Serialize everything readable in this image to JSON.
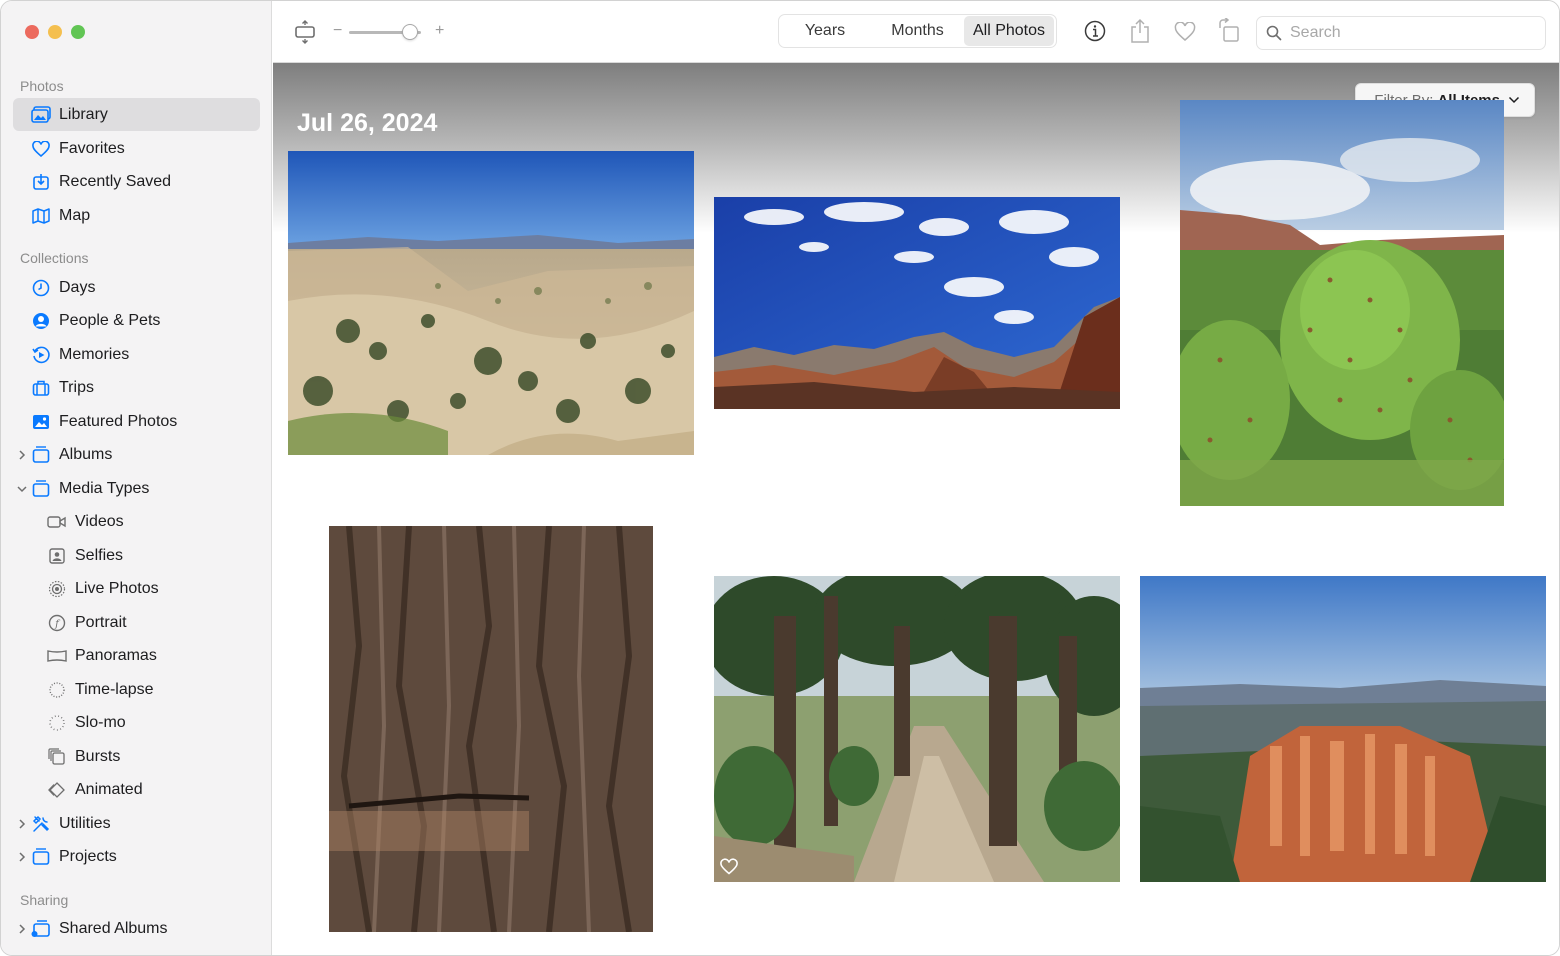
{
  "window": {
    "traffic_lights": {
      "close": "#ec6a5e",
      "minimize": "#f4bf4f",
      "zoom": "#61c554"
    }
  },
  "sidebar": {
    "sections": [
      {
        "label": "Photos",
        "items": [
          {
            "label": "Library",
            "icon": "library-icon",
            "selected": true
          },
          {
            "label": "Favorites",
            "icon": "heart-icon"
          },
          {
            "label": "Recently Saved",
            "icon": "recently-saved-icon"
          },
          {
            "label": "Map",
            "icon": "map-icon"
          }
        ]
      },
      {
        "label": "Collections",
        "items": [
          {
            "label": "Days",
            "icon": "clock-icon"
          },
          {
            "label": "People & Pets",
            "icon": "person-icon"
          },
          {
            "label": "Memories",
            "icon": "memories-icon"
          },
          {
            "label": "Trips",
            "icon": "suitcase-icon"
          },
          {
            "label": "Featured Photos",
            "icon": "featured-photos-icon"
          },
          {
            "label": "Albums",
            "icon": "folder-icon",
            "disclosure": "collapsed"
          },
          {
            "label": "Media Types",
            "icon": "folder-icon",
            "disclosure": "expanded"
          },
          {
            "label": "Videos",
            "icon": "video-icon",
            "sub": true
          },
          {
            "label": "Selfies",
            "icon": "selfie-icon",
            "sub": true
          },
          {
            "label": "Live Photos",
            "icon": "live-photo-icon",
            "sub": true
          },
          {
            "label": "Portrait",
            "icon": "portrait-icon",
            "sub": true
          },
          {
            "label": "Panoramas",
            "icon": "panorama-icon",
            "sub": true
          },
          {
            "label": "Time-lapse",
            "icon": "timelapse-icon",
            "sub": true
          },
          {
            "label": "Slo-mo",
            "icon": "slomo-icon",
            "sub": true
          },
          {
            "label": "Bursts",
            "icon": "bursts-icon",
            "sub": true
          },
          {
            "label": "Animated",
            "icon": "animated-icon",
            "sub": true
          },
          {
            "label": "Utilities",
            "icon": "utilities-icon",
            "disclosure": "collapsed"
          },
          {
            "label": "Projects",
            "icon": "folder-icon",
            "disclosure": "collapsed"
          }
        ]
      },
      {
        "label": "Sharing",
        "items": [
          {
            "label": "Shared Albums",
            "icon": "shared-albums-icon",
            "disclosure": "collapsed"
          }
        ]
      }
    ]
  },
  "toolbar": {
    "zoom_minus": "−",
    "zoom_plus": "+",
    "zoom_level": 0.85,
    "segments": [
      {
        "label": "Years",
        "active": false
      },
      {
        "label": "Months",
        "active": false
      },
      {
        "label": "All Photos",
        "active": true
      }
    ],
    "icons": [
      "info-icon",
      "share-icon",
      "heart-icon",
      "rotate-icon"
    ],
    "search_placeholder": "Search"
  },
  "content": {
    "date": "Jul 26, 2024",
    "filter_label": "Filter By:",
    "filter_value": "All Items",
    "photos": [
      "desert-overlook",
      "sky-canyon-cliffs",
      "prickly-pear-cactus",
      "tree-bark",
      "forest-trail",
      "hoodoo-canyon"
    ]
  },
  "colors": {
    "accent": "#0a7aff",
    "sidebar_bg": "#f4f3f4",
    "selected_bg": "#dedddf"
  }
}
